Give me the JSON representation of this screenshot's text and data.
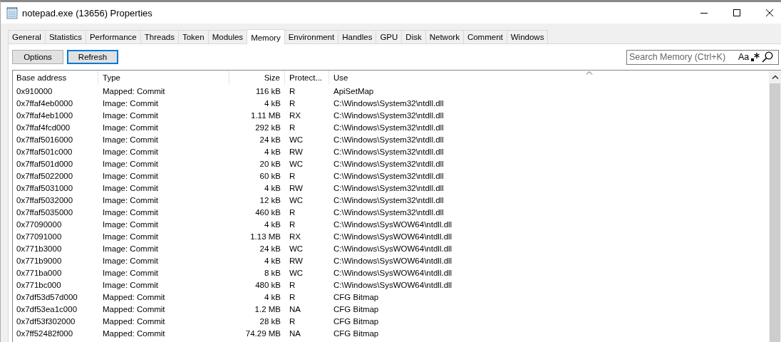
{
  "window": {
    "title": "notepad.exe (13656) Properties"
  },
  "tabs": [
    {
      "label": "General",
      "selected": false
    },
    {
      "label": "Statistics",
      "selected": false
    },
    {
      "label": "Performance",
      "selected": false
    },
    {
      "label": "Threads",
      "selected": false
    },
    {
      "label": "Token",
      "selected": false
    },
    {
      "label": "Modules",
      "selected": false
    },
    {
      "label": "Memory",
      "selected": true
    },
    {
      "label": "Environment",
      "selected": false
    },
    {
      "label": "Handles",
      "selected": false
    },
    {
      "label": "GPU",
      "selected": false
    },
    {
      "label": "Disk",
      "selected": false
    },
    {
      "label": "Network",
      "selected": false
    },
    {
      "label": "Comment",
      "selected": false
    },
    {
      "label": "Windows",
      "selected": false
    }
  ],
  "buttons": [
    {
      "label": "Options",
      "focused": false
    },
    {
      "label": "Refresh",
      "focused": true
    }
  ],
  "search": {
    "placeholder": "Search Memory (Ctrl+K)",
    "case_label": "Aa"
  },
  "table": {
    "columns": [
      {
        "label": "Base address",
        "sorted": false
      },
      {
        "label": "Type",
        "sorted": false
      },
      {
        "label": "Size",
        "sorted": false
      },
      {
        "label": "Protect...",
        "sorted": false
      },
      {
        "label": "Use",
        "sorted": true
      }
    ],
    "rows": [
      [
        "0x910000",
        "Mapped: Commit",
        "116 kB",
        "R",
        "ApiSetMap"
      ],
      [
        "0x7ffaf4eb0000",
        "Image: Commit",
        "4 kB",
        "R",
        "C:\\Windows\\System32\\ntdll.dll"
      ],
      [
        "0x7ffaf4eb1000",
        "Image: Commit",
        "1.11 MB",
        "RX",
        "C:\\Windows\\System32\\ntdll.dll"
      ],
      [
        "0x7ffaf4fcd000",
        "Image: Commit",
        "292 kB",
        "R",
        "C:\\Windows\\System32\\ntdll.dll"
      ],
      [
        "0x7ffaf5016000",
        "Image: Commit",
        "24 kB",
        "WC",
        "C:\\Windows\\System32\\ntdll.dll"
      ],
      [
        "0x7ffaf501c000",
        "Image: Commit",
        "4 kB",
        "RW",
        "C:\\Windows\\System32\\ntdll.dll"
      ],
      [
        "0x7ffaf501d000",
        "Image: Commit",
        "20 kB",
        "WC",
        "C:\\Windows\\System32\\ntdll.dll"
      ],
      [
        "0x7ffaf5022000",
        "Image: Commit",
        "60 kB",
        "R",
        "C:\\Windows\\System32\\ntdll.dll"
      ],
      [
        "0x7ffaf5031000",
        "Image: Commit",
        "4 kB",
        "RW",
        "C:\\Windows\\System32\\ntdll.dll"
      ],
      [
        "0x7ffaf5032000",
        "Image: Commit",
        "12 kB",
        "WC",
        "C:\\Windows\\System32\\ntdll.dll"
      ],
      [
        "0x7ffaf5035000",
        "Image: Commit",
        "460 kB",
        "R",
        "C:\\Windows\\System32\\ntdll.dll"
      ],
      [
        "0x77090000",
        "Image: Commit",
        "4 kB",
        "R",
        "C:\\Windows\\SysWOW64\\ntdll.dll"
      ],
      [
        "0x77091000",
        "Image: Commit",
        "1.13 MB",
        "RX",
        "C:\\Windows\\SysWOW64\\ntdll.dll"
      ],
      [
        "0x771b3000",
        "Image: Commit",
        "24 kB",
        "WC",
        "C:\\Windows\\SysWOW64\\ntdll.dll"
      ],
      [
        "0x771b9000",
        "Image: Commit",
        "4 kB",
        "RW",
        "C:\\Windows\\SysWOW64\\ntdll.dll"
      ],
      [
        "0x771ba000",
        "Image: Commit",
        "8 kB",
        "WC",
        "C:\\Windows\\SysWOW64\\ntdll.dll"
      ],
      [
        "0x771bc000",
        "Image: Commit",
        "480 kB",
        "R",
        "C:\\Windows\\SysWOW64\\ntdll.dll"
      ],
      [
        "0x7df53d57d000",
        "Mapped: Commit",
        "4 kB",
        "R",
        "CFG Bitmap"
      ],
      [
        "0x7df53ea1c000",
        "Mapped: Commit",
        "1.2 MB",
        "NA",
        "CFG Bitmap"
      ],
      [
        "0x7df53f302000",
        "Mapped: Commit",
        "28 kB",
        "R",
        "CFG Bitmap"
      ],
      [
        "0x7ff52482f000",
        "Mapped: Commit",
        "74.29 MB",
        "NA",
        "CFG Bitmap"
      ]
    ]
  }
}
